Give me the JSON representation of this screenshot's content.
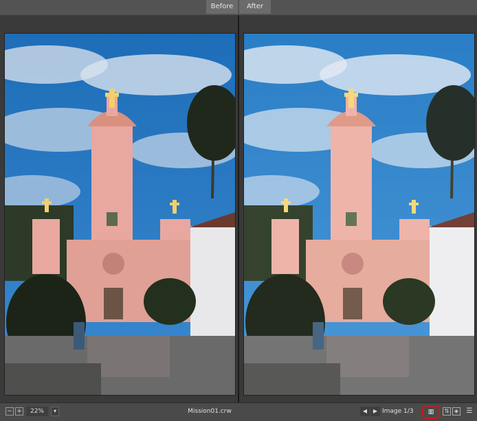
{
  "header": {
    "tab_before": "Before",
    "tab_after": "After"
  },
  "status": {
    "zoom_out_icon": "minus-icon",
    "zoom_in_icon": "plus-icon",
    "zoom_value": "22%",
    "filename": "Mission01.crw",
    "image_count": "Image 1/3",
    "prev_icon": "triangle-left-icon",
    "next_icon": "triangle-right-icon",
    "compare_icon": "split-view-icon",
    "swap_icon": "swap-icon",
    "fit_icon": "fit-icon",
    "adjust_icon": "sliders-icon"
  },
  "colors": {
    "sky_before": "#1f6fb8",
    "sky_after": "#2b7fc6",
    "church": "#e8a8a0",
    "cross": "#f4cf6a",
    "highlight_ring": "#d01818"
  }
}
